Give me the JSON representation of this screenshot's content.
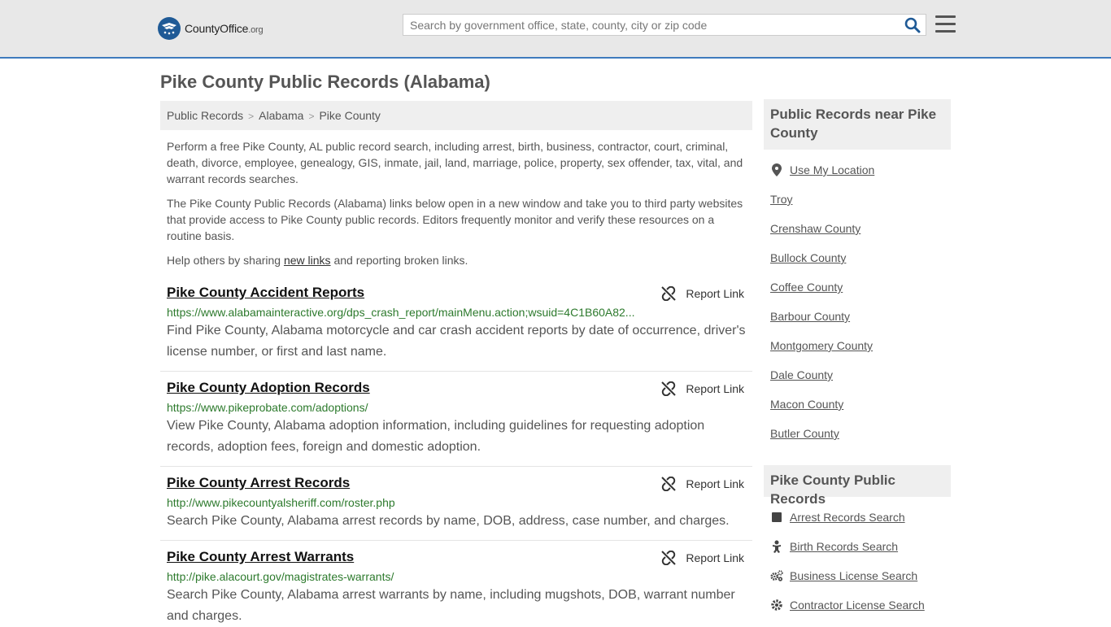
{
  "header": {
    "logo_main": "CountyOffice",
    "logo_suffix": ".org",
    "search_placeholder": "Search by government office, state, county, city or zip code"
  },
  "page_title": "Pike County Public Records (Alabama)",
  "breadcrumb": [
    "Public Records",
    "Alabama",
    "Pike County"
  ],
  "intro": {
    "p1": "Perform a free Pike County, AL public record search, including arrest, birth, business, contractor, court, criminal, death, divorce, employee, genealogy, GIS, inmate, jail, land, marriage, police, property, sex offender, tax, vital, and warrant records searches.",
    "p2": "The Pike County Public Records (Alabama) links below open in a new window and take you to third party websites that provide access to Pike County public records. Editors frequently monitor and verify these resources on a routine basis.",
    "p3_before": "Help others by sharing ",
    "p3_link": "new links",
    "p3_after": " and reporting broken links."
  },
  "report_label": "Report Link",
  "records": [
    {
      "title": "Pike County Accident Reports",
      "url": "https://www.alabamainteractive.org/dps_crash_report/mainMenu.action;wsuid=4C1B60A82...",
      "desc": "Find Pike County, Alabama motorcycle and car crash accident reports by date of occurrence, driver's license number, or first and last name."
    },
    {
      "title": "Pike County Adoption Records",
      "url": "https://www.pikeprobate.com/adoptions/",
      "desc": "View Pike County, Alabama adoption information, including guidelines for requesting adoption records, adoption fees, foreign and domestic adoption."
    },
    {
      "title": "Pike County Arrest Records",
      "url": "http://www.pikecountyalsheriff.com/roster.php",
      "desc": "Search Pike County, Alabama arrest records by name, DOB, address, case number, and charges."
    },
    {
      "title": "Pike County Arrest Warrants",
      "url": "http://pike.alacourt.gov/magistrates-warrants/",
      "desc": "Search Pike County, Alabama arrest warrants by name, including mugshots, DOB, warrant number and charges."
    }
  ],
  "sidebar": {
    "near_heading": "Public Records near Pike County",
    "use_location": "Use My Location",
    "near_links": [
      "Troy",
      "Crenshaw County",
      "Bullock County",
      "Coffee County",
      "Barbour County",
      "Montgomery County",
      "Dale County",
      "Macon County",
      "Butler County"
    ],
    "records_heading": "Pike County Public Records",
    "record_links": [
      {
        "label": "Arrest Records Search",
        "icon": "square-icon"
      },
      {
        "label": "Birth Records Search",
        "icon": "baby-icon"
      },
      {
        "label": "Business License Search",
        "icon": "gears-icon"
      },
      {
        "label": "Contractor License Search",
        "icon": "gear-icon"
      }
    ]
  }
}
